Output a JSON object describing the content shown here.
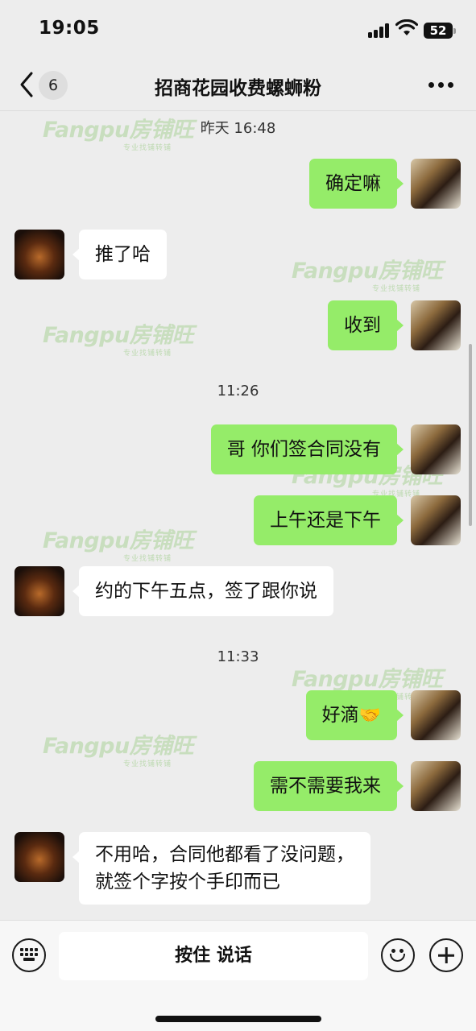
{
  "status_bar": {
    "time": "19:05",
    "battery": "52",
    "icons": [
      "signal-icon",
      "wifi-icon",
      "battery-icon"
    ]
  },
  "header": {
    "unread_count": "6",
    "title": "招商花园收费螺蛳粉",
    "icons": [
      "back-icon",
      "more-icon"
    ]
  },
  "messages": {
    "ts1": "昨天 16:48",
    "m1": "确定嘛",
    "m2": "推了哈",
    "m3": "收到",
    "ts2": "11:26",
    "m4": "哥 你们签合同没有",
    "m5": "上午还是下午",
    "m6": "约的下午五点，签了跟你说",
    "ts3": "11:33",
    "m7": "好滴",
    "m7_emoji": "🤝",
    "m8": "需不需要我来",
    "m9_line1": "不用哈，合同他都看了没问题，",
    "m9_line2": "就签个字按个手印而已"
  },
  "watermark": {
    "brand": "Fangpu房铺旺",
    "tagline": "专业找铺转铺"
  },
  "input_bar": {
    "talk_label": "按住 说话",
    "icons": [
      "keyboard-icon",
      "emoji-icon",
      "plus-icon"
    ]
  },
  "colors": {
    "background": "#ededed",
    "bubble_sent": "#95ec69",
    "bubble_received": "#ffffff",
    "watermark": "#78be5a"
  }
}
